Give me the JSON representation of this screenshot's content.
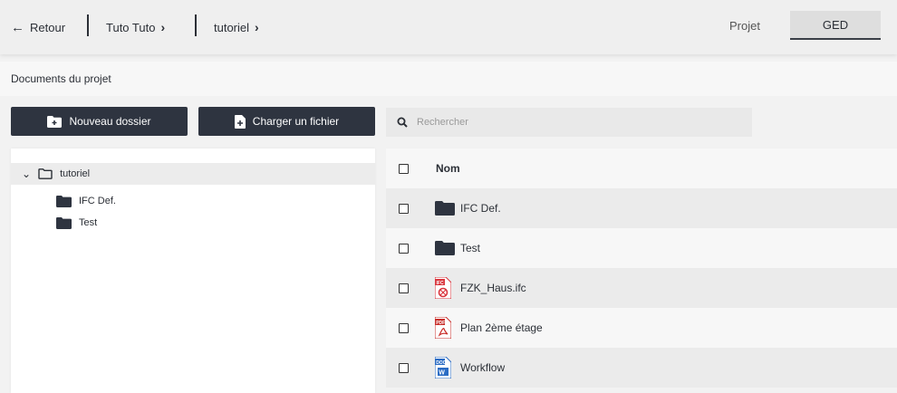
{
  "topbar": {
    "back_label": "Retour",
    "breadcrumbs": [
      "Tuto Tuto",
      "tutoriel"
    ],
    "tabs": [
      {
        "label": "Projet",
        "active": false
      },
      {
        "label": "GED",
        "active": true
      }
    ]
  },
  "section": {
    "title": "Documents du projet"
  },
  "actions": {
    "new_folder_label": "Nouveau dossier",
    "upload_label": "Charger un fichier"
  },
  "search": {
    "placeholder": "Rechercher",
    "value": ""
  },
  "tree": {
    "root": {
      "label": "tutoriel",
      "expanded": true
    },
    "children": [
      {
        "label": "IFC Def."
      },
      {
        "label": "Test"
      }
    ]
  },
  "list": {
    "header": "Nom",
    "rows": [
      {
        "name": "IFC Def.",
        "icon": "folder-icon"
      },
      {
        "name": "Test",
        "icon": "folder-icon"
      },
      {
        "name": "FZK_Haus.ifc",
        "icon": "ifc-file-icon"
      },
      {
        "name": "Plan 2ème étage",
        "icon": "pdf-file-icon"
      },
      {
        "name": "Workflow",
        "icon": "word-file-icon"
      }
    ]
  },
  "colors": {
    "primary": "#2e3440",
    "ifc_red": "#d9363e",
    "pdf_red": "#c9302c",
    "word_blue": "#2b6cc4"
  }
}
